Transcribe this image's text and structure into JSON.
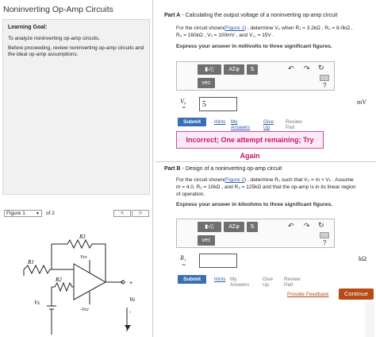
{
  "app": {
    "title": "Noninverting Op-Amp Circuits"
  },
  "goal": {
    "heading": "Learning Goal:",
    "line1": "To analyze noninverting op-amp circuits.",
    "line2": "Before proceeding, review noninverting op-amp circuits and the ideal op-amp assumptions."
  },
  "figure_nav": {
    "select_value": "Figure 1",
    "of": "of 2",
    "prev": "<",
    "next": ">"
  },
  "circuit_labels": {
    "r3": "R3",
    "r1": "R1",
    "r2": "R2",
    "vcc_top": "Vcc",
    "vcc_bot": "-Vcc",
    "vs": "Vs",
    "vo": "Vo",
    "plus": "+",
    "minus": "-"
  },
  "partA": {
    "label": "Part A",
    "title": " - Calculating the output voltage of a noninverting op-amp circuit",
    "q1a": "For the circuit shown(",
    "q1link": "Figure 1",
    "q1b": ") , determine V₀ when  R₁ = 3.2kΩ , R₂ = 8.0kΩ ,",
    "q2": "R₃ = 160kΩ , Vₛ = 100mV , and V꜀꜀ = 15V .",
    "express": "Express your answer in millivolts to three significant figures.",
    "answer_label": "V₀",
    "answer_eq": "=",
    "answer_value": "5",
    "unit": "mV",
    "submit": "Submit",
    "hints": "Hints",
    "my_answers": "My Answers",
    "give_up": "Give Up",
    "review": "Review Part",
    "feedback": "Incorrect; One attempt remaining; Try Again"
  },
  "partB": {
    "label": "Part B",
    "title": " - Design of a noninverting op-amp circuit",
    "q1a": "For the circuit shown(",
    "q1link": "Figure 2",
    "q1b": ") , determine R₁ such that V₀ = m × Vₛ . Assume",
    "q2": "m = 4.0, R₂ = 10kΩ , and R₃ = 125kΩ and that the op-amp is in its linear region",
    "q3": "of operation.",
    "express": "Express your answer in kiloohms to three significant figures.",
    "answer_label": "R₁",
    "answer_eq": "=",
    "answer_value": "",
    "unit": "kΩ",
    "submit": "Submit",
    "hints": "Hints",
    "my_answers": "My Answers",
    "give_up": "Give Up",
    "review": "Review Part"
  },
  "toolbar": {
    "sqrt": "▮√▯",
    "sigma": "ΑΣφ",
    "arrows": "⇅",
    "vec": "vec",
    "help": "?",
    "undo": "↶",
    "redo": "↷",
    "reset": "↻"
  },
  "footer": {
    "feedback": "Provide Feedback",
    "continue": "Continue"
  }
}
